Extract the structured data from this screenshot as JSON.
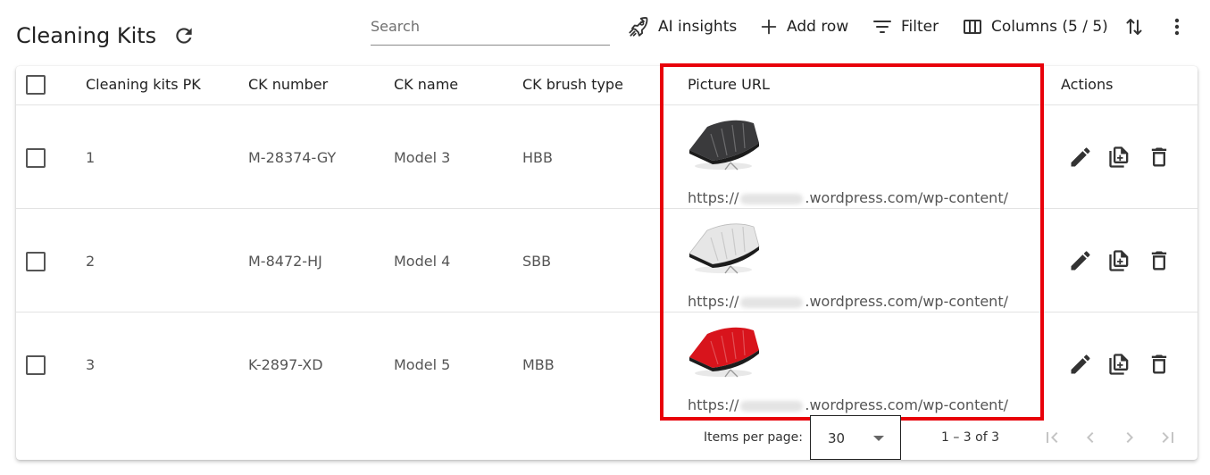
{
  "header": {
    "title": "Cleaning Kits",
    "search_placeholder": "Search",
    "ai_insights_label": "AI insights",
    "add_row_label": "Add row",
    "filter_label": "Filter",
    "columns_label": "Columns (5 / 5)"
  },
  "table": {
    "columns": [
      "Cleaning kits PK",
      "CK number",
      "CK name",
      "CK brush type",
      "Picture URL",
      "Actions"
    ],
    "rows": [
      {
        "pk": "1",
        "ck_number": "M-28374-GY",
        "ck_name": "Model 3",
        "brush_type": "HBB",
        "brush_color": "#3a3a3c",
        "url_prefix": "https://",
        "url_suffix": ".wordpress.com/wp-content/"
      },
      {
        "pk": "2",
        "ck_number": "M-8472-HJ",
        "ck_name": "Model 4",
        "brush_type": "SBB",
        "brush_color": "#e6e6e6",
        "url_prefix": "https://",
        "url_suffix": ".wordpress.com/wp-content/"
      },
      {
        "pk": "3",
        "ck_number": "K-2897-XD",
        "ck_name": "Model 5",
        "brush_type": "MBB",
        "brush_color": "#d8141c",
        "url_prefix": "https://",
        "url_suffix": ".wordpress.com/wp-content/"
      }
    ]
  },
  "pager": {
    "items_per_page_label": "Items per page:",
    "items_per_page_value": "30",
    "range_label": "1 – 3 of 3"
  },
  "colors": {
    "highlight": "#e8000a",
    "icon": "#333333",
    "disabled_icon": "#c4c4c4"
  },
  "icons": [
    "refresh-icon",
    "rocket-icon",
    "plus-icon",
    "filter-icon",
    "columns-icon",
    "sort-icon",
    "more-vert-icon",
    "edit-icon",
    "duplicate-icon",
    "delete-icon",
    "first-page-icon",
    "prev-page-icon",
    "next-page-icon",
    "last-page-icon"
  ]
}
